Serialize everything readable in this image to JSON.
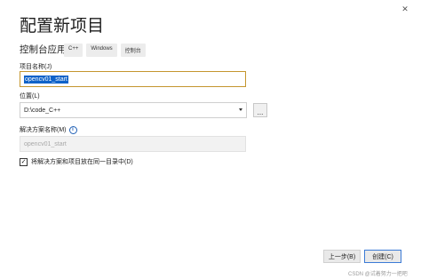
{
  "window": {
    "title": "配置新项目",
    "close_glyph": "✕"
  },
  "template": {
    "name": "控制台应用",
    "tags": [
      "C++",
      "Windows",
      "控制台"
    ]
  },
  "fields": {
    "project_name": {
      "label": "项目名称(J)",
      "value": "opencv01_start"
    },
    "location": {
      "label": "位置(L)",
      "value": "D:\\code_C++",
      "browse_label": "..."
    },
    "solution_name": {
      "label": "解决方案名称(M)",
      "info_glyph": "i",
      "value": "opencv01_start"
    },
    "same_directory": {
      "label": "将解决方案和项目放在同一目录中(D)",
      "checked": true,
      "check_glyph": "✓"
    }
  },
  "footer": {
    "back_label": "上一步(B)",
    "create_label": "创建(C)"
  },
  "watermark": "CSDN @试着努力一把吧",
  "colors": {
    "focus_border": "#c5962f",
    "selection": "#0f62c8",
    "primary_border": "#3c7bd6",
    "info_icon": "#1f5fb5"
  }
}
